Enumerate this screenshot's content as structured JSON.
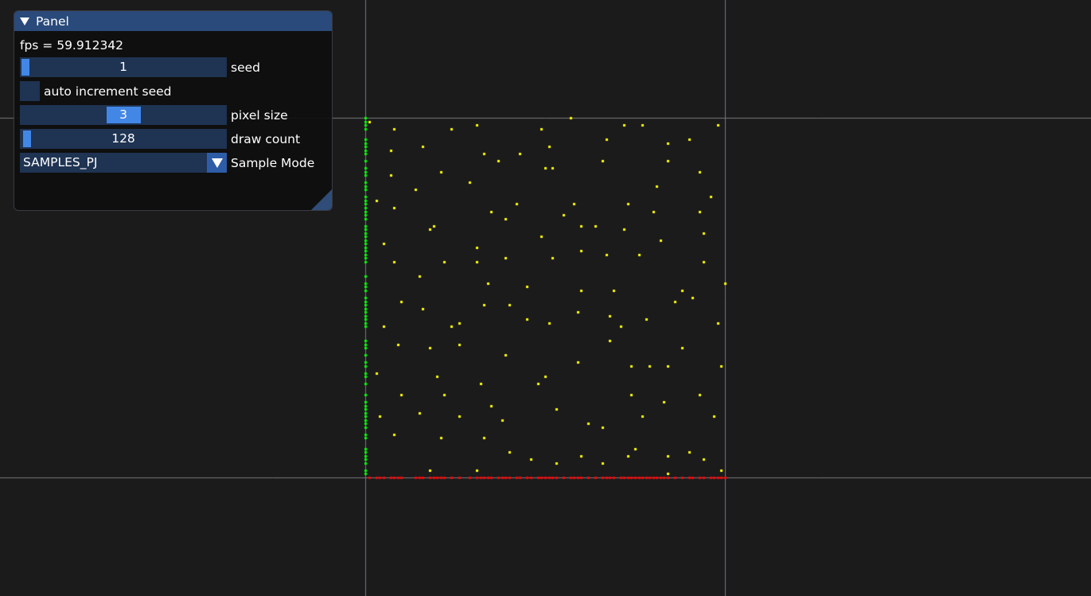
{
  "panel": {
    "title": "Panel",
    "fps_text": "fps = 59.912342",
    "seed": {
      "value": "1",
      "label": "seed",
      "fraction": 0.0
    },
    "auto_increment": {
      "label": "auto increment seed",
      "checked": false
    },
    "pixel_size": {
      "value": "3",
      "label": "pixel size",
      "fraction": 0.5
    },
    "draw_count": {
      "value": "128",
      "label": "draw count",
      "fraction": 0.01
    },
    "sample_mode": {
      "value": "SAMPLES_PJ",
      "label": "Sample Mode"
    }
  },
  "colors": {
    "background": "#1b1b1c",
    "guide_lines": "#7a7a7a",
    "samples": "#ffff00",
    "y_projection": "#00ff00",
    "x_projection": "#ff0000",
    "title_bar": "#294a7a",
    "frame": "#1f3352",
    "grab": "#4287e6"
  },
  "samples": [
    [
      0.01,
      0.99
    ],
    [
      0.08,
      0.97
    ],
    [
      0.24,
      0.97
    ],
    [
      0.31,
      0.98
    ],
    [
      0.49,
      0.97
    ],
    [
      0.57,
      1.0
    ],
    [
      0.72,
      0.98
    ],
    [
      0.77,
      0.98
    ],
    [
      0.98,
      0.98
    ],
    [
      0.07,
      0.91
    ],
    [
      0.16,
      0.92
    ],
    [
      0.33,
      0.9
    ],
    [
      0.37,
      0.88
    ],
    [
      0.43,
      0.9
    ],
    [
      0.51,
      0.92
    ],
    [
      0.67,
      0.94
    ],
    [
      0.84,
      0.93
    ],
    [
      0.9,
      0.94
    ],
    [
      0.5,
      0.86
    ],
    [
      0.52,
      0.86
    ],
    [
      0.66,
      0.88
    ],
    [
      0.84,
      0.88
    ],
    [
      0.07,
      0.84
    ],
    [
      0.21,
      0.85
    ],
    [
      0.29,
      0.82
    ],
    [
      0.14,
      0.8
    ],
    [
      0.81,
      0.81
    ],
    [
      0.96,
      0.78
    ],
    [
      0.93,
      0.85
    ],
    [
      0.03,
      0.77
    ],
    [
      0.08,
      0.75
    ],
    [
      0.42,
      0.76
    ],
    [
      0.35,
      0.74
    ],
    [
      0.39,
      0.72
    ],
    [
      0.55,
      0.73
    ],
    [
      0.58,
      0.76
    ],
    [
      0.73,
      0.76
    ],
    [
      0.8,
      0.74
    ],
    [
      0.93,
      0.74
    ],
    [
      0.19,
      0.7
    ],
    [
      0.18,
      0.69
    ],
    [
      0.64,
      0.7
    ],
    [
      0.72,
      0.69
    ],
    [
      0.05,
      0.65
    ],
    [
      0.31,
      0.64
    ],
    [
      0.49,
      0.67
    ],
    [
      0.6,
      0.7
    ],
    [
      0.82,
      0.66
    ],
    [
      0.94,
      0.68
    ],
    [
      0.6,
      0.63
    ],
    [
      0.67,
      0.62
    ],
    [
      0.76,
      0.62
    ],
    [
      0.08,
      0.6
    ],
    [
      0.22,
      0.6
    ],
    [
      0.31,
      0.6
    ],
    [
      0.39,
      0.61
    ],
    [
      0.52,
      0.61
    ],
    [
      0.94,
      0.6
    ],
    [
      0.15,
      0.56
    ],
    [
      0.34,
      0.54
    ],
    [
      0.45,
      0.53
    ],
    [
      0.6,
      0.52
    ],
    [
      0.69,
      0.52
    ],
    [
      1.0,
      0.54
    ],
    [
      0.88,
      0.52
    ],
    [
      0.91,
      0.5
    ],
    [
      0.86,
      0.49
    ],
    [
      0.1,
      0.49
    ],
    [
      0.16,
      0.47
    ],
    [
      0.33,
      0.48
    ],
    [
      0.4,
      0.48
    ],
    [
      0.59,
      0.46
    ],
    [
      0.68,
      0.45
    ],
    [
      0.05,
      0.42
    ],
    [
      0.26,
      0.43
    ],
    [
      0.24,
      0.42
    ],
    [
      0.45,
      0.44
    ],
    [
      0.51,
      0.43
    ],
    [
      0.71,
      0.42
    ],
    [
      0.78,
      0.44
    ],
    [
      0.98,
      0.43
    ],
    [
      0.09,
      0.37
    ],
    [
      0.18,
      0.36
    ],
    [
      0.26,
      0.37
    ],
    [
      0.39,
      0.34
    ],
    [
      0.68,
      0.38
    ],
    [
      0.88,
      0.36
    ],
    [
      0.59,
      0.32
    ],
    [
      0.74,
      0.31
    ],
    [
      0.79,
      0.31
    ],
    [
      0.84,
      0.31
    ],
    [
      0.99,
      0.31
    ],
    [
      0.03,
      0.29
    ],
    [
      0.2,
      0.28
    ],
    [
      0.5,
      0.28
    ],
    [
      0.48,
      0.26
    ],
    [
      0.32,
      0.26
    ],
    [
      0.22,
      0.23
    ],
    [
      0.1,
      0.23
    ],
    [
      0.74,
      0.23
    ],
    [
      0.93,
      0.23
    ],
    [
      0.35,
      0.2
    ],
    [
      0.53,
      0.19
    ],
    [
      0.83,
      0.21
    ],
    [
      0.97,
      0.17
    ],
    [
      0.04,
      0.17
    ],
    [
      0.15,
      0.18
    ],
    [
      0.26,
      0.17
    ],
    [
      0.38,
      0.16
    ],
    [
      0.77,
      0.17
    ],
    [
      0.62,
      0.15
    ],
    [
      0.66,
      0.14
    ],
    [
      0.08,
      0.12
    ],
    [
      0.21,
      0.11
    ],
    [
      0.33,
      0.11
    ],
    [
      0.75,
      0.08
    ],
    [
      0.66,
      0.04
    ],
    [
      0.6,
      0.06
    ],
    [
      0.73,
      0.06
    ],
    [
      0.9,
      0.07
    ],
    [
      0.4,
      0.07
    ],
    [
      0.46,
      0.05
    ],
    [
      0.53,
      0.04
    ],
    [
      0.18,
      0.02
    ],
    [
      0.31,
      0.02
    ],
    [
      0.84,
      0.01
    ],
    [
      0.99,
      0.02
    ],
    [
      0.84,
      0.06
    ],
    [
      0.94,
      0.05
    ]
  ]
}
